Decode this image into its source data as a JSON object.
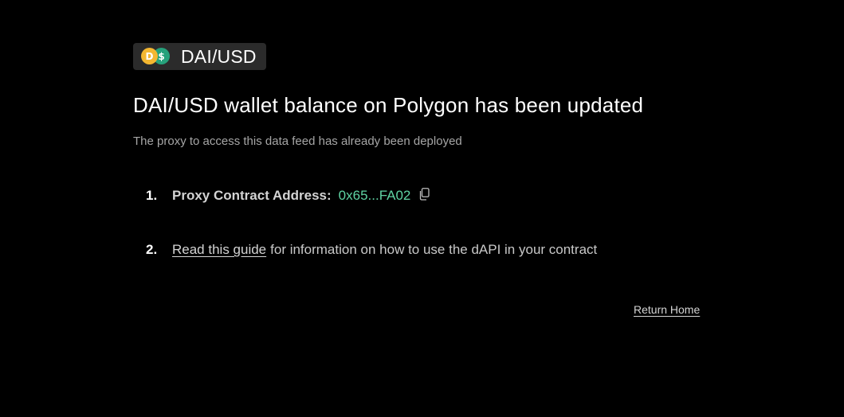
{
  "badge": {
    "pair": "DAI/USD",
    "icons": [
      "dai-coin-icon",
      "usd-coin-icon"
    ],
    "dai_glyph": "D",
    "usd_glyph": "$",
    "colors": {
      "dai": "#f4b731",
      "usd": "#26a17b"
    }
  },
  "header": {
    "title": "DAI/USD wallet balance on Polygon has been updated",
    "subtitle": "The proxy to access this data feed has already been deployed"
  },
  "steps": [
    {
      "number": "1.",
      "label": "Proxy Contract Address:",
      "address": "0x65...FA02",
      "icon": "copy-icon"
    },
    {
      "number": "2.",
      "link_text": "Read this guide",
      "rest_text": "for information on how to use the dAPI in your contract"
    }
  ],
  "footer": {
    "return_home": "Return Home"
  },
  "colors": {
    "background": "#000000",
    "address_accent": "#5fd3a3",
    "badge_bg": "#2b2b2b"
  }
}
